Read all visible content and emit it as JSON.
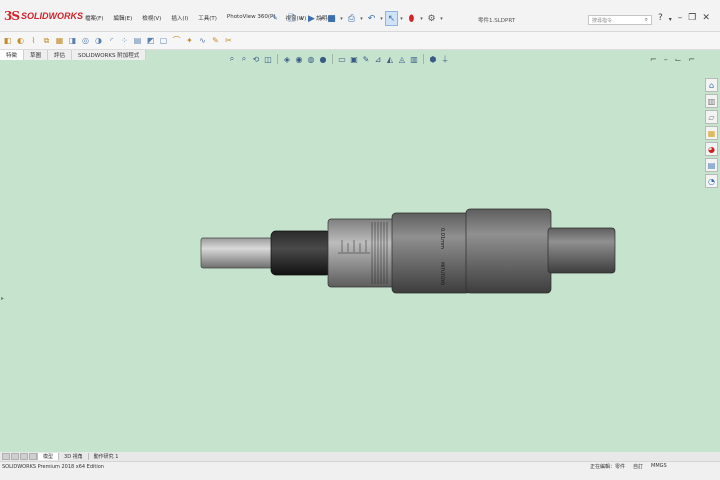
{
  "app": {
    "logo_mark": "3S",
    "logo_text": "SOLIDWORKS"
  },
  "menu": [
    {
      "label": "檔案(F)"
    },
    {
      "label": "編輯(E)"
    },
    {
      "label": "檢視(V)"
    },
    {
      "label": "插入(I)"
    },
    {
      "label": "工具(T)"
    },
    {
      "label": "PhotoView 360(P)"
    },
    {
      "label": "視窗(W)"
    },
    {
      "label": "說明(H)"
    }
  ],
  "doc_title": "零件1.SLDPRT",
  "search": {
    "placeholder": "搜尋指令"
  },
  "tabs": [
    {
      "label": "特徵"
    },
    {
      "label": "草圖"
    },
    {
      "label": "評估"
    },
    {
      "label": "SOLIDWORKS 附加程式"
    }
  ],
  "bottom_tabs": [
    {
      "label": "模型"
    },
    {
      "label": "3D 視角"
    },
    {
      "label": "動作研究 1"
    }
  ],
  "status": {
    "left": "SOLIDWORKS Premium 2018 x64 Edition",
    "right": [
      {
        "label": "正在編輯：零件"
      },
      {
        "label": "自訂"
      },
      {
        "label": "MMGS"
      }
    ]
  },
  "micrometer": {
    "thimble_label": "0.01mm",
    "sleeve_label": "MITUTOYO"
  },
  "colors": {
    "viewport": "#c5e3cd",
    "logo": "#d2232a",
    "accent": "#3a6fb0"
  }
}
